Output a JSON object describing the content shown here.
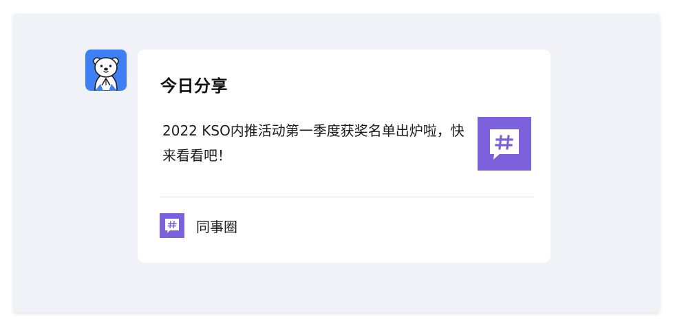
{
  "message": {
    "sender_avatar": "otter-avatar-icon",
    "card": {
      "title": "今日分享",
      "body": "2022 KSO内推活动第一季度获奖名单出炉啦，快来看看吧！",
      "thumbnail_icon": "hashtag-chat-icon",
      "source": {
        "icon": "hashtag-chat-icon",
        "label": "同事圈"
      }
    }
  },
  "colors": {
    "background": "#f0f2f7",
    "card": "#ffffff",
    "avatar_bg": "#3d7ff4",
    "accent": "#7b62dc"
  }
}
